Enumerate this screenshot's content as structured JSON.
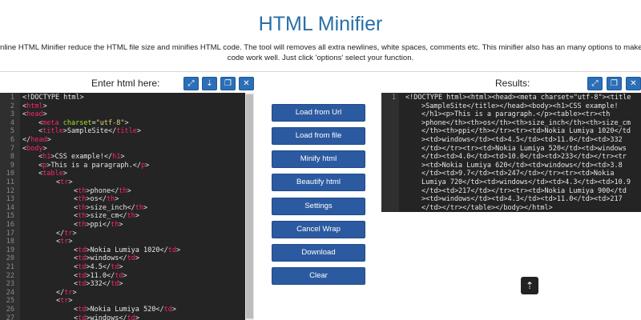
{
  "header": {
    "title": "HTML Minifier",
    "desc_line1": "nline HTML Minifier reduce the HTML file size and minifies HTML code. The tool will removes all extra newlines, white spaces, comments etc. This minifier also has an many options to make you",
    "desc_line2": "code work well. Just click 'options' select your function."
  },
  "input_panel": {
    "label": "Enter html here:"
  },
  "output_panel": {
    "label": "Results:"
  },
  "actions": {
    "load_url": "Load from Url",
    "load_file": "Load from file",
    "minify": "Minify html",
    "beautify": "Beautify html",
    "settings": "Settings",
    "cancel_wrap": "Cancel Wrap",
    "download": "Download",
    "clear": "Clear"
  },
  "icons": {
    "expand": "expand-icon",
    "copy": "copy-icon",
    "paste": "paste-icon",
    "close": "close-icon",
    "scroll_top": "arrow-up-icon"
  },
  "colors": {
    "title": "#2a6fa8",
    "button": "#2c5aa0",
    "editor_bg": "#242424",
    "tag": "#f92672",
    "attr": "#a6e22e",
    "string": "#e6db74"
  },
  "input_lines": [
    "1",
    "2",
    "3",
    "4",
    "5",
    "6",
    "7",
    "8",
    "9",
    "10",
    "11",
    "12",
    "13",
    "14",
    "15",
    "16",
    "17",
    "18",
    "19",
    "20",
    "21",
    "22",
    "23",
    "24",
    "25",
    "26",
    "27"
  ],
  "output": {
    "line_number": "1",
    "lines": [
      "<!DOCTYPE html><html><head><meta charset=\"utf-8\"><title",
      ">SampleSite</title></head><body><h1>CSS example!",
      "</h1><p>This is a paragraph.</p><table><tr><th",
      ">phone</th><th>os</th><th>size_inch</th><th>size_cm",
      "</th><th>ppi</th></tr><tr><td>Nokia Lumiya 1020</td",
      "><td>windows</td><td>4.5</td><td>11.0</td><td>332",
      "</td></tr><tr><td>Nokia Lumiya 520</td><td>windows",
      "</td><td>4.0</td><td>10.0</td><td>233</td></tr><tr",
      "><td>Nokia Lumiya 620</td><td>windows</td><td>3.8",
      "</td><td>9.7</td><td>247</td></tr><tr><td>Nokia",
      "Lumiya 720</td><td>windows</td><td>4.3</td><td>10.9",
      "</td><td>217</td></tr><tr><td>Nokia Lumiya 900</td",
      "><td>windows</td><td>4.3</td><td>11.0</td><td>217",
      "</td></tr></table></body></html>"
    ]
  }
}
